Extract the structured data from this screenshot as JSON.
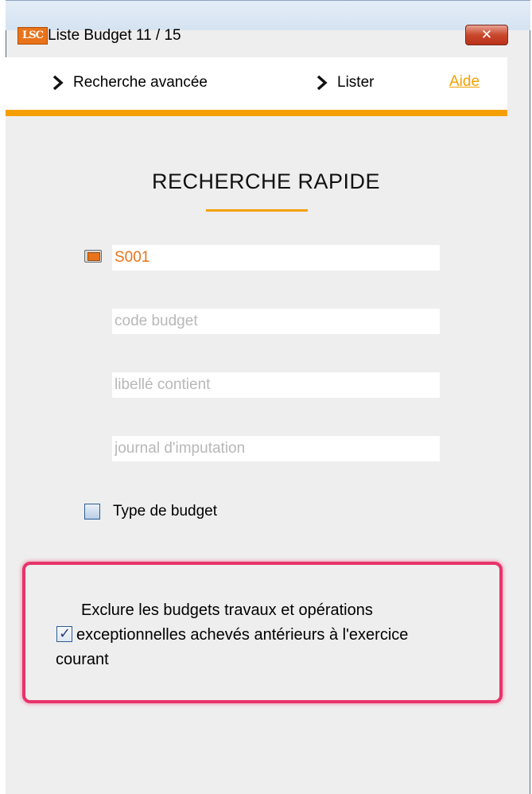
{
  "window": {
    "logo_text": "LSC",
    "title": "Liste  Budget 11 / 15",
    "close_label": "✕"
  },
  "menu": {
    "advanced_search": "Recherche avancée",
    "list": "Lister",
    "help": "Aide"
  },
  "main": {
    "heading": "RECHERCHE RAPIDE",
    "fields": {
      "filter_value": "S001",
      "code_placeholder": "code budget",
      "libelle_placeholder": "libellé contient",
      "journal_placeholder": "journal d'imputation"
    },
    "type_checkbox": {
      "label": "Type de budget",
      "checked": false
    },
    "exclude_checkbox": {
      "line1": "Exclure les budgets travaux et opérations",
      "line2": "exceptionnelles achevés antérieurs à l'exercice",
      "line3": "courant",
      "checked": true
    }
  },
  "colors": {
    "accent": "#f5a000",
    "logo": "#e8731a",
    "highlight": "#e8336a"
  }
}
